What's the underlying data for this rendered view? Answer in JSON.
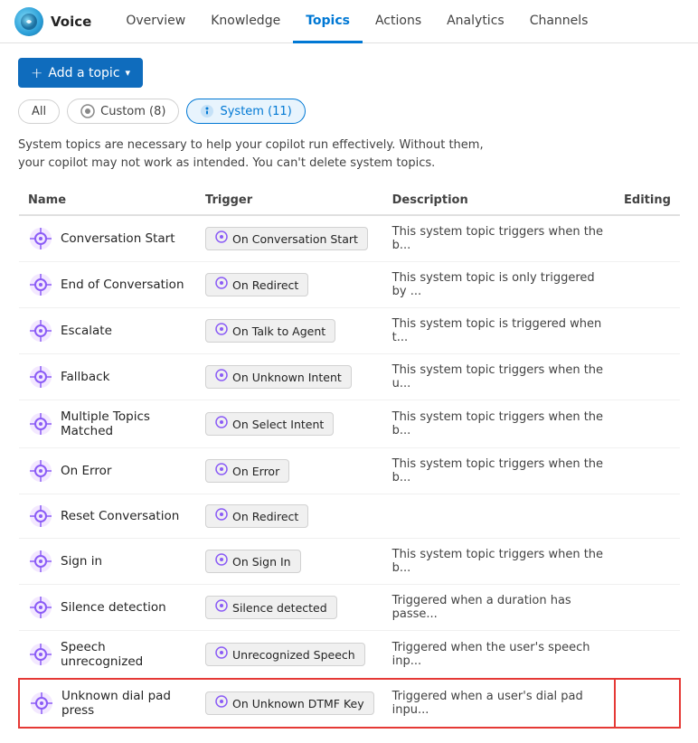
{
  "app": {
    "logo_alt": "Voice logo",
    "name": "Voice"
  },
  "nav": {
    "items": [
      {
        "label": "Overview",
        "active": false
      },
      {
        "label": "Knowledge",
        "active": false
      },
      {
        "label": "Topics",
        "active": true
      },
      {
        "label": "Actions",
        "active": false
      },
      {
        "label": "Analytics",
        "active": false
      },
      {
        "label": "Channels",
        "active": false
      }
    ]
  },
  "toolbar": {
    "add_button": "+ Add a topic ▾"
  },
  "filters": {
    "all_label": "All",
    "custom_label": "Custom (8)",
    "system_label": "System (11)"
  },
  "info_text": "System topics are necessary to help your copilot run effectively. Without them, your copilot may not work as intended. You can't delete system topics.",
  "table": {
    "headers": {
      "name": "Name",
      "trigger": "Trigger",
      "description": "Description",
      "editing": "Editing"
    },
    "rows": [
      {
        "name": "Conversation Start",
        "trigger": "On Conversation Start",
        "description": "This system topic triggers when the b...",
        "highlight": false
      },
      {
        "name": "End of Conversation",
        "trigger": "On Redirect",
        "description": "This system topic is only triggered by ...",
        "highlight": false
      },
      {
        "name": "Escalate",
        "trigger": "On Talk to Agent",
        "description": "This system topic is triggered when t...",
        "highlight": false
      },
      {
        "name": "Fallback",
        "trigger": "On Unknown Intent",
        "description": "This system topic triggers when the u...",
        "highlight": false
      },
      {
        "name": "Multiple Topics Matched",
        "trigger": "On Select Intent",
        "description": "This system topic triggers when the b...",
        "highlight": false
      },
      {
        "name": "On Error",
        "trigger": "On Error",
        "description": "This system topic triggers when the b...",
        "highlight": false
      },
      {
        "name": "Reset Conversation",
        "trigger": "On Redirect",
        "description": "",
        "highlight": false
      },
      {
        "name": "Sign in",
        "trigger": "On Sign In",
        "description": "This system topic triggers when the b...",
        "highlight": false
      },
      {
        "name": "Silence detection",
        "trigger": "Silence detected",
        "description": "Triggered when a duration has passe...",
        "highlight": false
      },
      {
        "name": "Speech unrecognized",
        "trigger": "Unrecognized Speech",
        "description": "Triggered when the user's speech inp...",
        "highlight": false
      },
      {
        "name": "Unknown dial pad press",
        "trigger": "On Unknown DTMF Key",
        "description": "Triggered when a user's dial pad inpu...",
        "highlight": true
      }
    ]
  }
}
